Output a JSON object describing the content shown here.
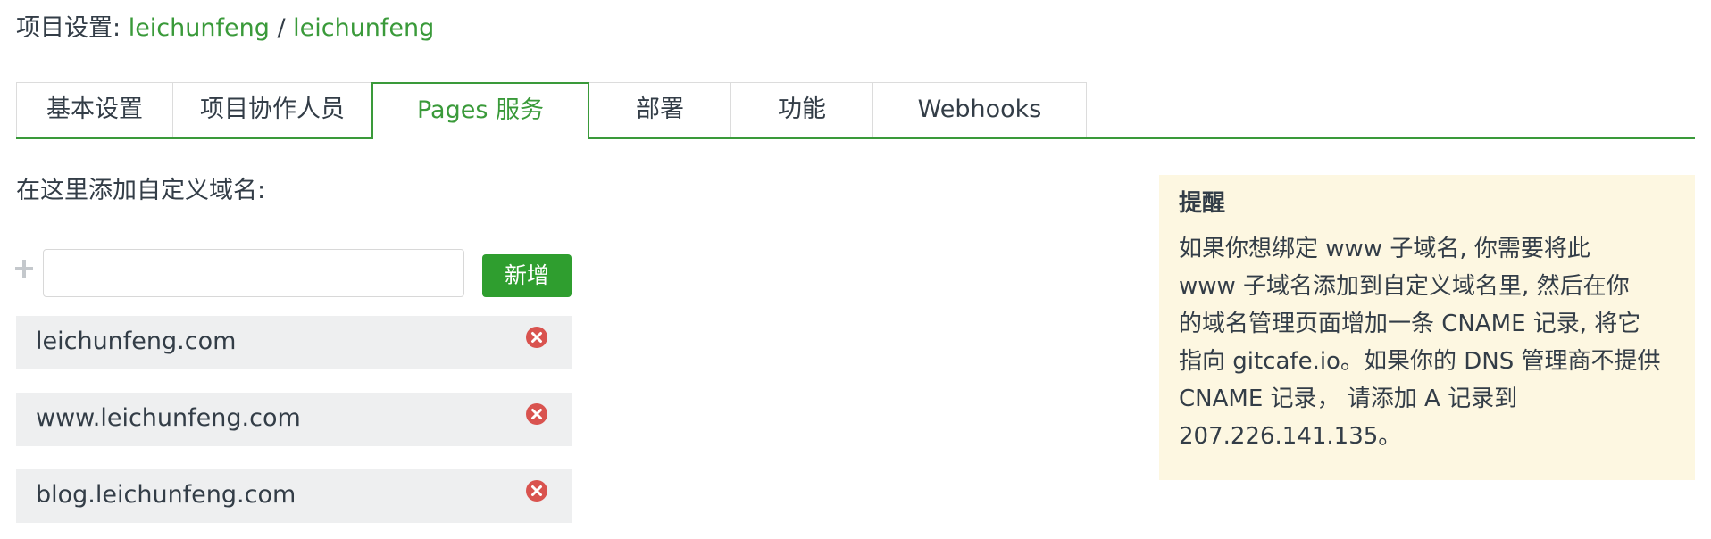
{
  "breadcrumb": {
    "prefix": "项目设置: ",
    "owner": "leichunfeng",
    "separator": " / ",
    "project": "leichunfeng"
  },
  "tabs": [
    {
      "label": "基本设置",
      "active": false
    },
    {
      "label": "项目协作人员",
      "active": false
    },
    {
      "label": "Pages 服务",
      "active": true
    },
    {
      "label": "部署",
      "active": false
    },
    {
      "label": "功能",
      "active": false
    },
    {
      "label": "Webhooks",
      "active": false
    }
  ],
  "custom_domain": {
    "label": "在这里添加自定义域名:",
    "input_value": "",
    "input_placeholder": "",
    "add_button_label": "新增",
    "domains": [
      "leichunfeng.com",
      "www.leichunfeng.com",
      "blog.leichunfeng.com"
    ]
  },
  "notice": {
    "title": "提醒",
    "lines": [
      "如果你想绑定 www 子域名, 你需要将此",
      "www 子域名添加到自定义域名里, 然后在你",
      "的域名管理页面增加一条 CNAME 记录, 将它",
      "指向 gitcafe.io。如果你的 DNS 管理商不提供",
      "CNAME 记录， 请添加 A 记录到",
      "207.226.141.135。"
    ]
  },
  "colors": {
    "accent_green": "#3a9a3a",
    "button_green": "#2f9e2f",
    "remove_red": "#d9534f",
    "notice_background": "#fdf7e1",
    "row_background": "#eeeff0"
  },
  "icons": {
    "plus": "plus-icon",
    "remove": "remove-circle-icon"
  }
}
